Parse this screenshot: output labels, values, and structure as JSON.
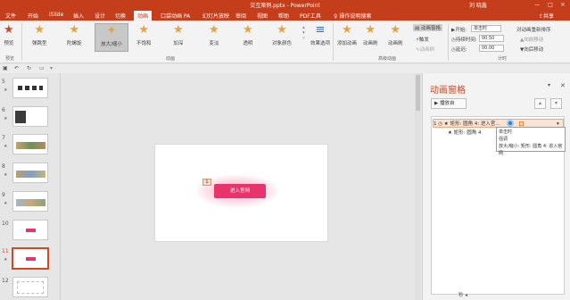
{
  "window": {
    "doc_title": "交互案例.pptx - PowerPoint",
    "user": "刘 晓鑫",
    "controls": [
      "—",
      "□",
      "✕"
    ]
  },
  "tabs": [
    "文件",
    "开始",
    "iSlide",
    "插入",
    "设计",
    "切换",
    "动画",
    "口袋动画 PA",
    "幻灯片放映",
    "审阅",
    "视图",
    "帮助",
    "PDF工具",
    "操作说明搜索",
    "共享"
  ],
  "active_tab": "动画",
  "ribbon": {
    "preview": "预览",
    "effects": [
      "弹跳型",
      "陀螺旋",
      "放大/缩小",
      "不饱和",
      "加深",
      "变淡",
      "透明",
      "对象颜色"
    ],
    "effect_options": "效果选项",
    "add_animation": "添加动画",
    "animation_painter": "动画刷",
    "animation_pane_btn": "动画窗格",
    "trigger": "触发",
    "anim_painter2": "动画刷",
    "start_label": "开始:",
    "start_value": "单击时",
    "duration_label": "持续时间:",
    "duration_value": "00.50",
    "delay_label": "延迟:",
    "delay_value": "00.00",
    "reorder": "对动画重新排序",
    "move_earlier": "向前移动",
    "move_later": "向后移动",
    "groups": {
      "preview": "预览",
      "animation": "动画",
      "advanced": "高级动画",
      "timing": "计时"
    }
  },
  "qat_icons": [
    "save-icon",
    "undo-icon",
    "redo-icon",
    "present-icon"
  ],
  "thumbs": [
    {
      "num": "5",
      "star": "★",
      "selected": false
    },
    {
      "num": "6",
      "star": "★",
      "selected": false
    },
    {
      "num": "7",
      "star": "★",
      "selected": false
    },
    {
      "num": "8",
      "star": "★",
      "selected": false
    },
    {
      "num": "9",
      "star": "★",
      "selected": false
    },
    {
      "num": "10",
      "star": "",
      "selected": false
    },
    {
      "num": "11",
      "star": "★",
      "selected": true
    },
    {
      "num": "12",
      "star": "",
      "selected": false
    }
  ],
  "slide": {
    "button_text": "进入官网",
    "anim_tag": "1"
  },
  "pane": {
    "title": "动画窗格",
    "play_label": "▶ 播放自",
    "items": [
      {
        "label": "1 ◷ ★ 矩形: 圆角 4: 进入官...",
        "selected": true
      },
      {
        "label": "★ 矩形: 圆角 4",
        "selected": false
      }
    ],
    "tooltip": [
      "单击时",
      "强调",
      "放大/缩小: 矩形: 圆角 4: 进入官网"
    ],
    "status": "秒 ◂"
  },
  "colors": {
    "brand": "#c43e1c",
    "cta": "#e8336b",
    "pane_title": "#c04a2a"
  }
}
